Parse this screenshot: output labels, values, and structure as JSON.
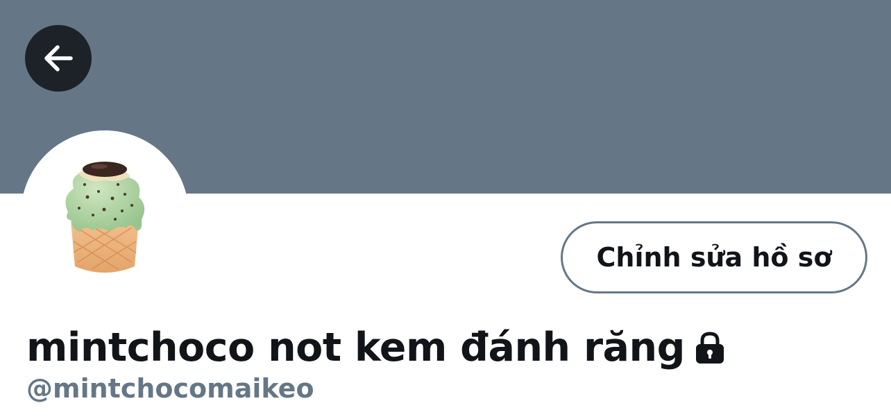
{
  "header": {
    "banner_color": "#657786",
    "back_icon": "arrow-left-icon"
  },
  "profile": {
    "avatar_icon": "ice-cream-cone-icon",
    "display_name": "mintchoco not kem đánh răng",
    "protected_icon": "lock-icon",
    "handle": "@mintchocomaikeo"
  },
  "actions": {
    "edit_profile_label": "Chỉnh sửa hồ sơ"
  },
  "colors": {
    "text_primary": "#111418",
    "text_secondary": "#657786",
    "back_button_bg": "#1c2227"
  }
}
